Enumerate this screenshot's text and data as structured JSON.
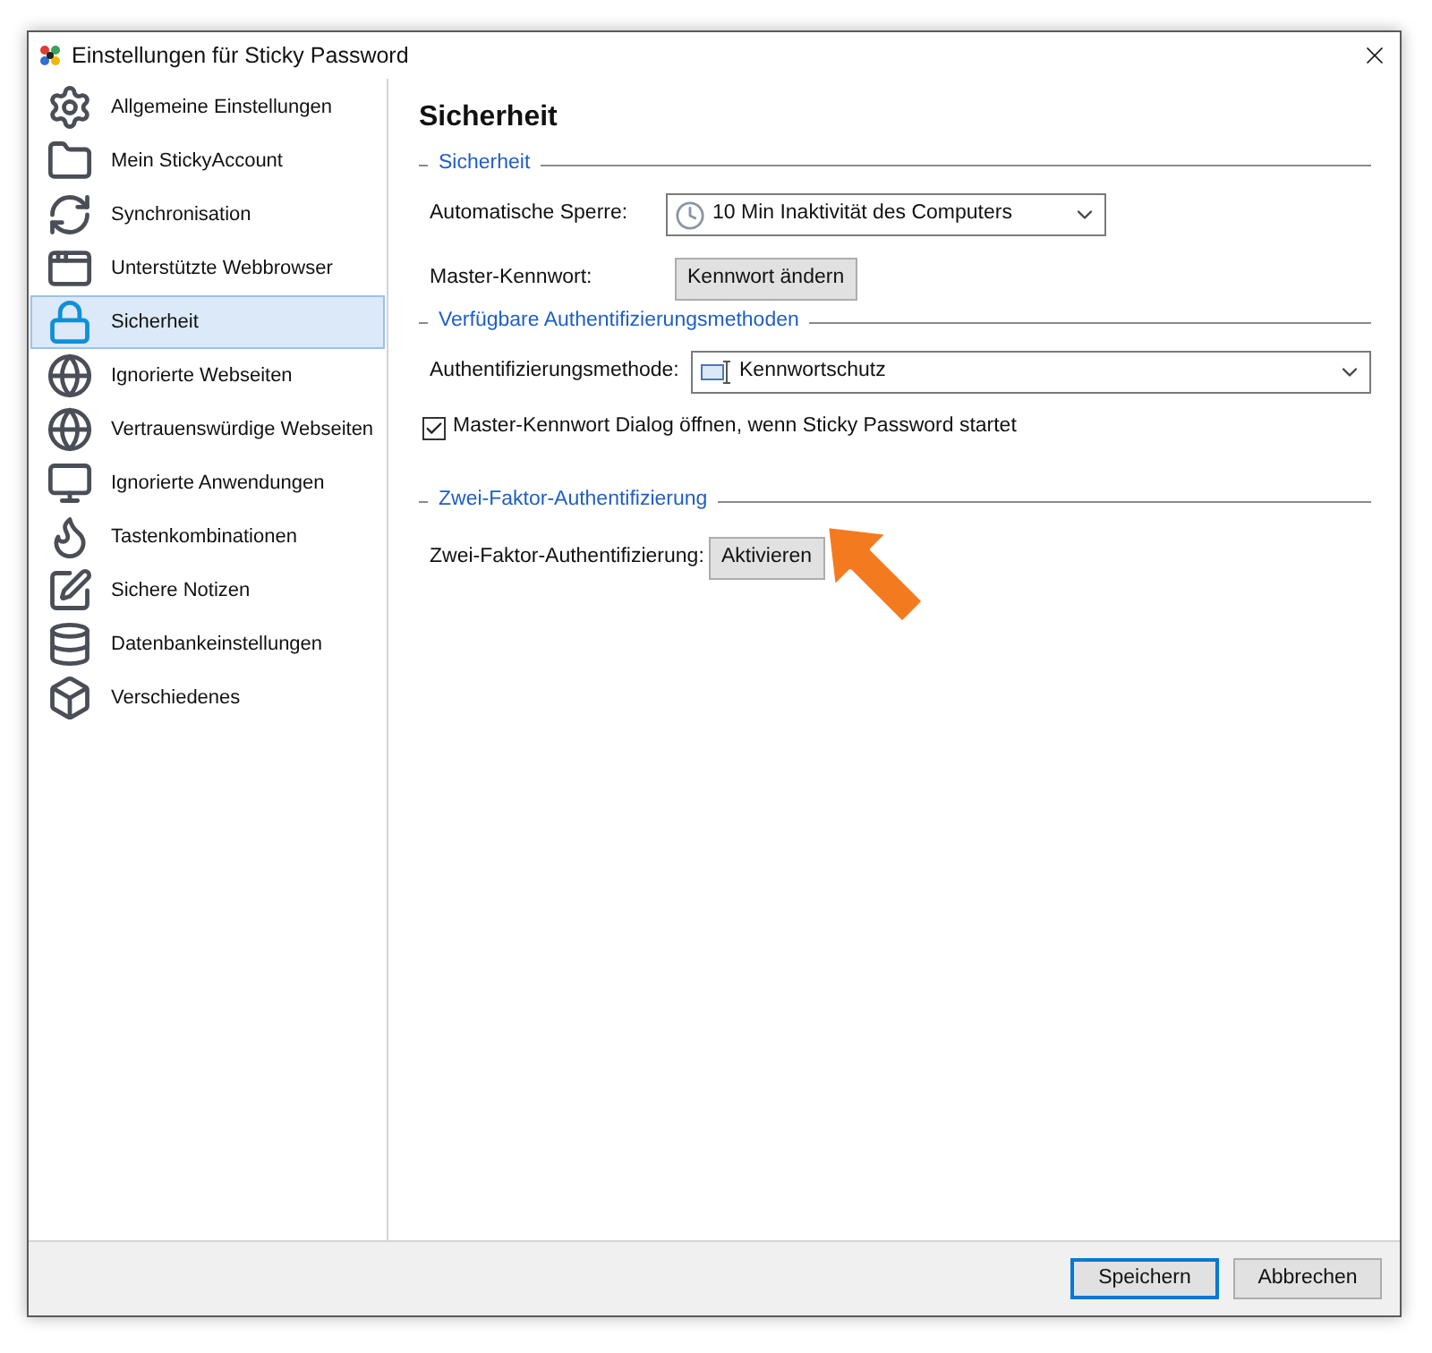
{
  "window": {
    "title": "Einstellungen für Sticky Password"
  },
  "sidebar": {
    "items": [
      {
        "label": "Allgemeine Einstellungen",
        "selected": false
      },
      {
        "label": "Mein StickyAccount",
        "selected": false
      },
      {
        "label": "Synchronisation",
        "selected": false
      },
      {
        "label": "Unterstützte Webbrowser",
        "selected": false
      },
      {
        "label": "Sicherheit",
        "selected": true
      },
      {
        "label": "Ignorierte Webseiten",
        "selected": false
      },
      {
        "label": "Vertrauenswürdige Webseiten",
        "selected": false
      },
      {
        "label": "Ignorierte Anwendungen",
        "selected": false
      },
      {
        "label": "Tastenkombinationen",
        "selected": false
      },
      {
        "label": "Sichere Notizen",
        "selected": false
      },
      {
        "label": "Datenbankeinstellungen",
        "selected": false
      },
      {
        "label": "Verschiedenes",
        "selected": false
      }
    ]
  },
  "page_title": "Sicherheit",
  "sections": [
    {
      "title": "Sicherheit",
      "rows": [
        {
          "kind": "select",
          "label": "Automatische Sperre:",
          "value": "10 Min Inaktivität des Computers"
        },
        {
          "kind": "button",
          "label": "Master-Kennwort:",
          "button": "Kennwort ändern"
        }
      ]
    },
    {
      "title": "Verfügbare Authentifizierungsmethoden",
      "rows": [
        {
          "kind": "select",
          "label": "Authentifizierungsmethode:",
          "value": "Kennwortschutz"
        },
        {
          "kind": "checkbox",
          "label": "Master-Kennwort Dialog öffnen, wenn Sticky Password startet",
          "checked": true
        }
      ]
    },
    {
      "title": "Zwei-Faktor-Authentifizierung",
      "rows": [
        {
          "kind": "button",
          "label": "Zwei-Faktor-Authentifizierung:",
          "button": "Aktivieren"
        }
      ]
    }
  ],
  "footer": {
    "buttons": [
      {
        "label": "Speichern",
        "selected": true
      },
      {
        "label": "Abbrechen",
        "selected": false
      }
    ]
  }
}
